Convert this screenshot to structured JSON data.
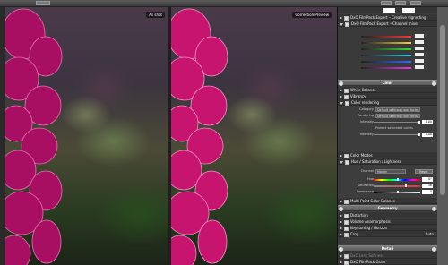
{
  "viewer": {
    "left_label": "As shot",
    "right_label": "Correction Preview"
  },
  "palettes": {
    "filmpack_signature": "DxO FilmPack Expert – Creative vignetting",
    "channel_mixer": "DxO FilmPack Expert – Channel mixer",
    "sections": {
      "color": "Color",
      "geometry": "Geometry",
      "detail": "Detail"
    },
    "white_balance": "White Balance",
    "vibrancy": "Vibrancy",
    "color_rendering": "Color rendering",
    "color_rendering_rows": {
      "category_label": "Category",
      "category_value": "Default settings (raw: factor...",
      "rendering_label": "Rendering",
      "rendering_value": "Default settings (raw: factor...",
      "intensity_label": "Intensity",
      "intensity_value": "100",
      "protect_label": "Protect saturated colors",
      "intensity2_label": "Intensity",
      "intensity2_value": "100"
    },
    "color_modes": "Color Modes",
    "hsl": "Hue / Saturation / Lightness",
    "hsl_rows": {
      "channel_label": "Channel",
      "channel_value": "Master",
      "reset_label": "Reset",
      "hue_label": "Hue",
      "hue_value": "0°",
      "saturation_label": "Saturation",
      "saturation_value": "36",
      "luminance_label": "Luminance",
      "luminance_value": "0"
    },
    "multi_point": "Multi-Point Color Balance",
    "distortion": "Distortion",
    "volume_anamorphosis": "Volume Anamorphosis",
    "keystoning": "Keystoning / Horizon",
    "crop": "Crop",
    "crop_value": "Auto",
    "lens_softness": "DxO Lens Softness",
    "filmpack_grain": "DxO FilmPack Grain"
  },
  "colors": {
    "accent": "#c7146f",
    "panel": "#3d3d3d",
    "header": "#666666"
  }
}
